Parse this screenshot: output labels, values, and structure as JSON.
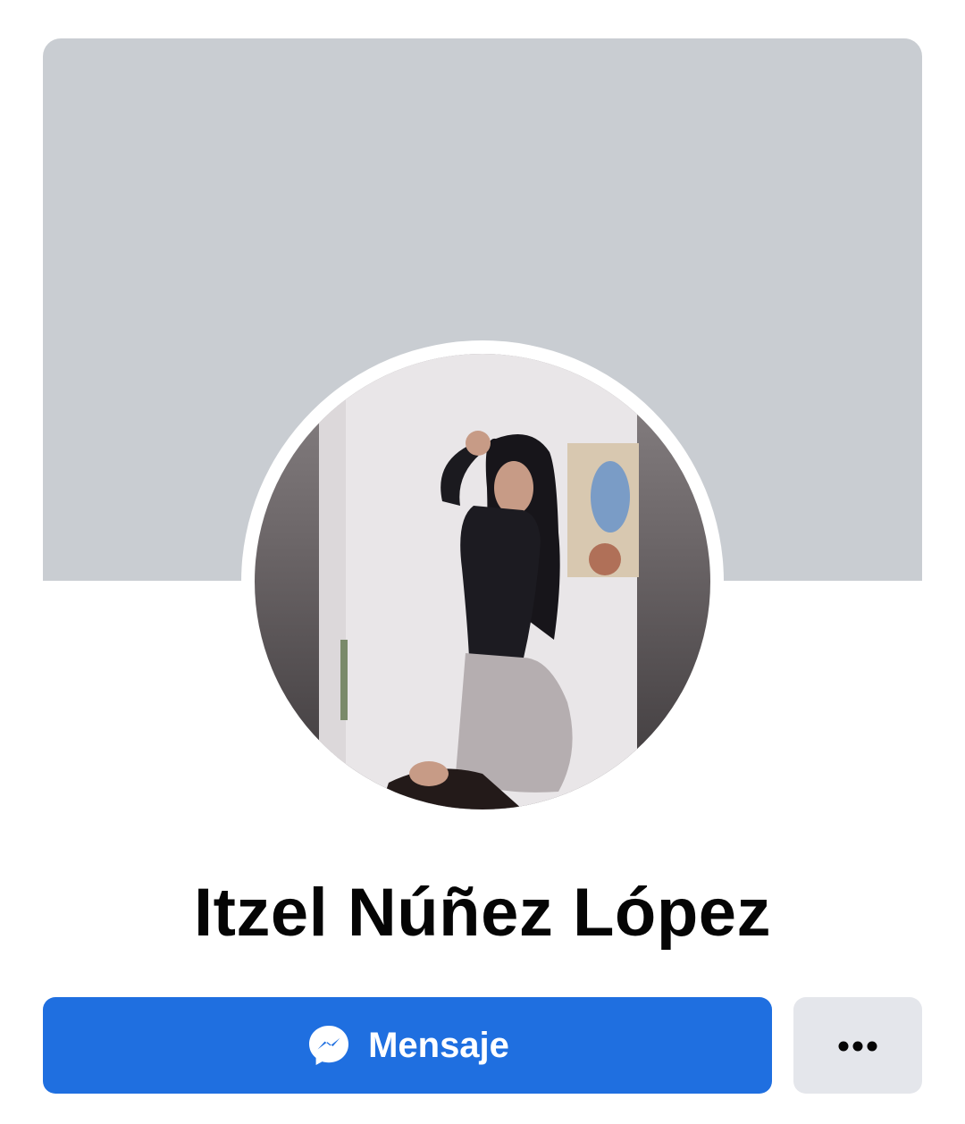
{
  "profile": {
    "name": "Itzel Núñez López"
  },
  "actions": {
    "message_label": "Mensaje",
    "message_icon": "messenger-icon",
    "more_icon": "more-horizontal-icon"
  },
  "colors": {
    "cover": "#c9cdd2",
    "primary_button": "#1f6fe0",
    "secondary_button": "#e4e6eb",
    "name_text": "#050505"
  }
}
